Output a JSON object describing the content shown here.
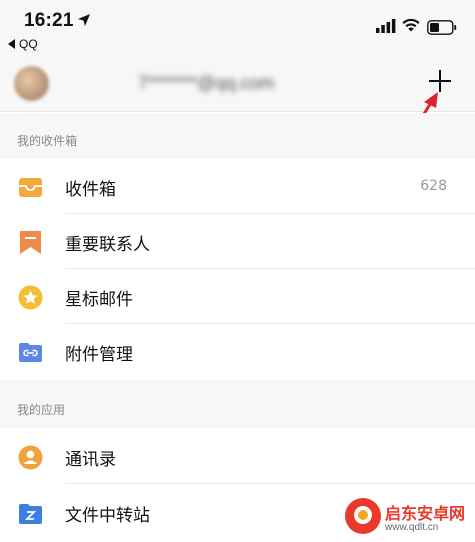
{
  "status_bar": {
    "time": "16:21",
    "back_app": "QQ"
  },
  "account": {
    "email": "7*******@qq.com",
    "add_icon": "plus-icon"
  },
  "sections": [
    {
      "title": "我的收件箱",
      "items": [
        {
          "label": "收件箱",
          "count": "628",
          "icon": "inbox-icon",
          "color": "#f4a93b"
        },
        {
          "label": "重要联系人",
          "count": "",
          "icon": "bookmark-icon",
          "color": "#ef8a4a"
        },
        {
          "label": "星标邮件",
          "count": "",
          "icon": "star-icon",
          "color": "#f4be33"
        },
        {
          "label": "附件管理",
          "count": "",
          "icon": "attachment-icon",
          "color": "#5d86e6"
        }
      ]
    },
    {
      "title": "我的应用",
      "items": [
        {
          "label": "通讯录",
          "count": "",
          "icon": "contacts-icon",
          "color": "#f2a23d"
        },
        {
          "label": "文件中转站",
          "count": "",
          "icon": "folder-icon",
          "color": "#3d7fe0"
        }
      ]
    }
  ],
  "watermark": {
    "title": "启东安卓网",
    "url": "www.qdlt.cn"
  }
}
